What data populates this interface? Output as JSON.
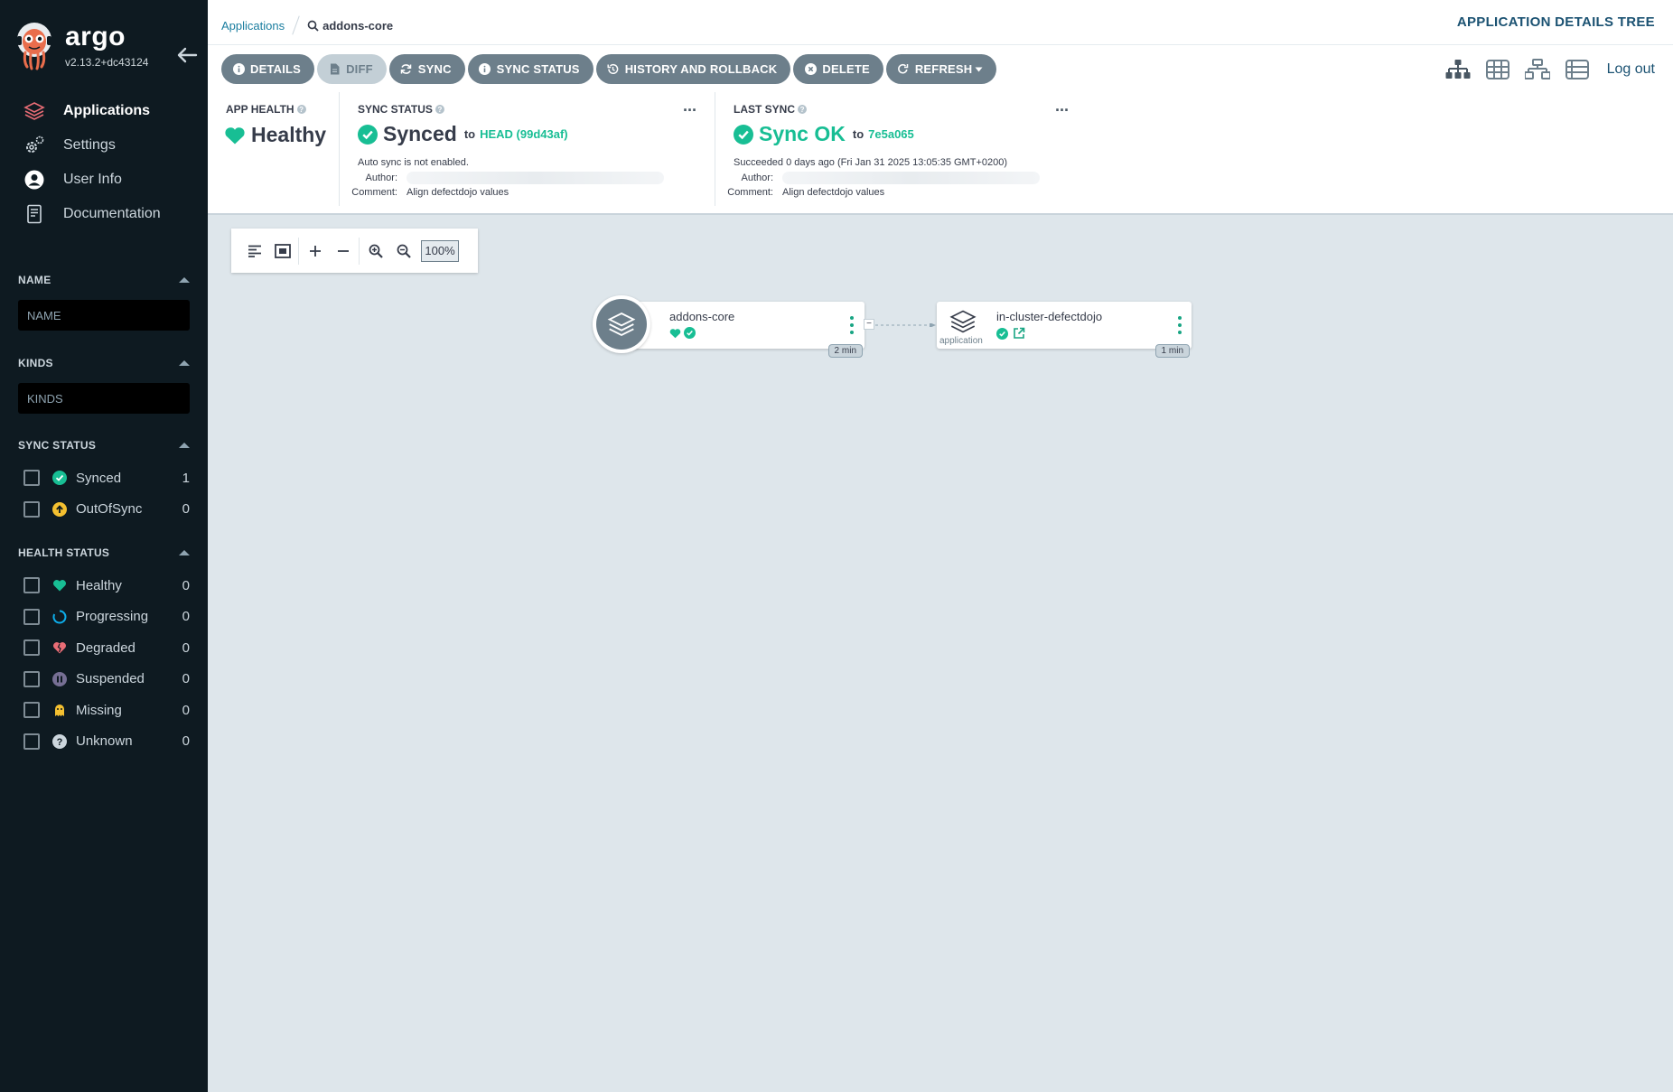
{
  "app": {
    "brand": "argo",
    "version": "v2.13.2+dc43124"
  },
  "sidebar": {
    "nav": [
      {
        "label": "Applications",
        "icon": "stack-icon",
        "active": true
      },
      {
        "label": "Settings",
        "icon": "gears-icon"
      },
      {
        "label": "User Info",
        "icon": "user-circle-icon"
      },
      {
        "label": "Documentation",
        "icon": "book-icon"
      }
    ],
    "filters": {
      "name": {
        "label": "NAME",
        "placeholder": "NAME"
      },
      "kinds": {
        "label": "KINDS",
        "placeholder": "KINDS"
      },
      "sync_status": {
        "label": "SYNC STATUS",
        "items": [
          {
            "label": "Synced",
            "count": "1",
            "icon": "check-circle-icon",
            "color": "#18be94"
          },
          {
            "label": "OutOfSync",
            "count": "0",
            "icon": "arrow-up-circle-icon",
            "color": "#f4c030"
          }
        ]
      },
      "health_status": {
        "label": "HEALTH STATUS",
        "items": [
          {
            "label": "Healthy",
            "count": "0",
            "icon": "heart-icon",
            "color": "#18be94"
          },
          {
            "label": "Progressing",
            "count": "0",
            "icon": "circle-notch-icon",
            "color": "#0dadea"
          },
          {
            "label": "Degraded",
            "count": "0",
            "icon": "heart-broken-icon",
            "color": "#e96d76"
          },
          {
            "label": "Suspended",
            "count": "0",
            "icon": "pause-circle-icon",
            "color": "#766f94"
          },
          {
            "label": "Missing",
            "count": "0",
            "icon": "ghost-icon",
            "color": "#f4c030"
          },
          {
            "label": "Unknown",
            "count": "0",
            "icon": "question-circle-icon",
            "color": "#ccd6dd"
          }
        ]
      }
    }
  },
  "header": {
    "breadcrumb_root": "Applications",
    "breadcrumb_current": "addons-core",
    "title": "APPLICATION DETAILS TREE"
  },
  "toolbar": {
    "buttons": [
      {
        "label": "DETAILS",
        "icon": "info-circle-icon"
      },
      {
        "label": "DIFF",
        "icon": "file-icon",
        "disabled": true
      },
      {
        "label": "SYNC",
        "icon": "sync-icon"
      },
      {
        "label": "SYNC STATUS",
        "icon": "info-circle-icon"
      },
      {
        "label": "HISTORY AND ROLLBACK",
        "icon": "history-icon"
      },
      {
        "label": "DELETE",
        "icon": "times-circle-icon"
      },
      {
        "label": "REFRESH",
        "icon": "redo-icon",
        "has_dropdown": true
      }
    ],
    "views": [
      "tree-view-icon",
      "pods-view-icon",
      "network-view-icon",
      "list-view-icon"
    ],
    "logout": "Log out"
  },
  "status": {
    "app_health": {
      "title": "APP HEALTH",
      "value": "Healthy"
    },
    "sync_status": {
      "title": "SYNC STATUS",
      "value": "Synced",
      "to": "to",
      "revision": "HEAD (99d43af)",
      "auto_sync": "Auto sync is not enabled.",
      "author_label": "Author:",
      "comment_label": "Comment:",
      "comment": "Align defectdojo values"
    },
    "last_sync": {
      "title": "LAST SYNC",
      "value": "Sync OK",
      "to": "to",
      "revision": "7e5a065",
      "succeeded": "Succeeded 0 days ago (Fri Jan 31 2025 13:05:35 GMT+0200)",
      "author_label": "Author:",
      "comment_label": "Comment:",
      "comment": "Align defectdojo values"
    }
  },
  "graph": {
    "zoom": "100%",
    "nodes": [
      {
        "name": "addons-core",
        "age": "2 min"
      },
      {
        "name": "in-cluster-defectdojo",
        "kind": "application",
        "age": "1 min"
      }
    ]
  },
  "colors": {
    "sidebar_bg": "#0e1a21",
    "accent": "#18be94",
    "button": "#6d7f8b",
    "title": "#1b5272"
  }
}
